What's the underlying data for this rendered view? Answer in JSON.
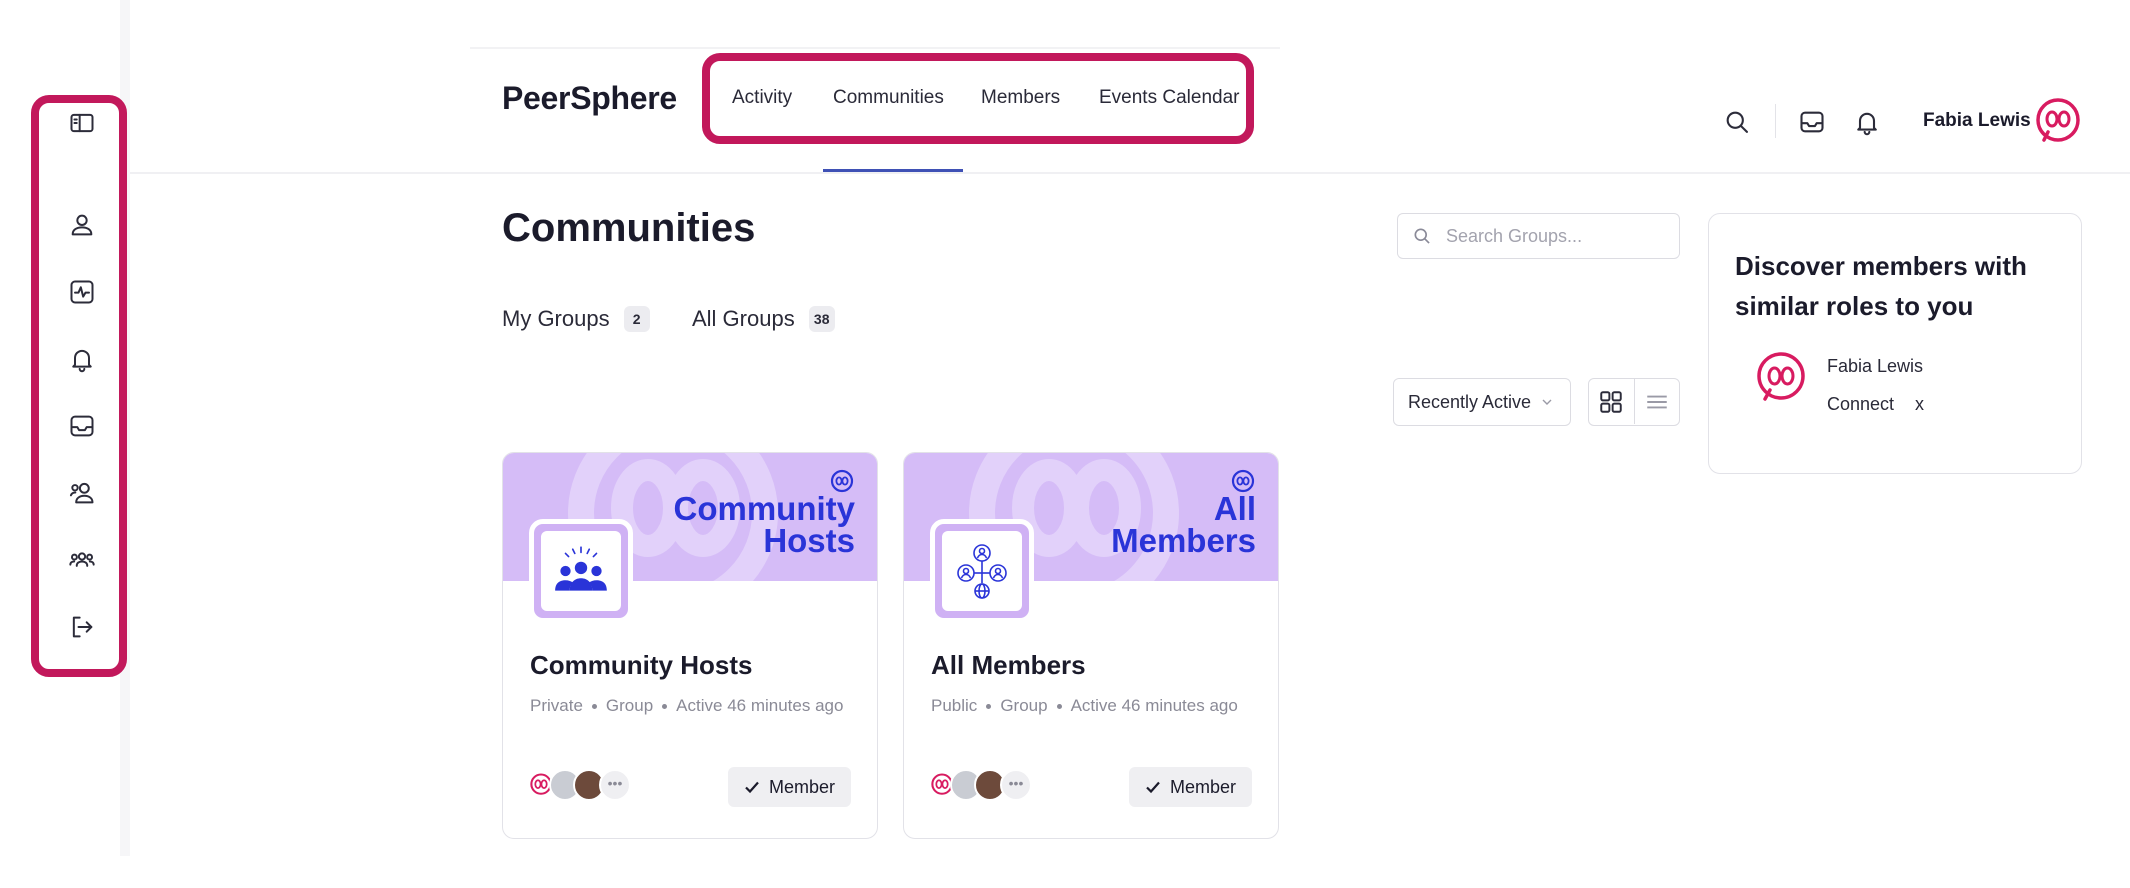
{
  "brand": "PeerSphere",
  "nav": {
    "items": [
      {
        "label": "Activity"
      },
      {
        "label": "Communities"
      },
      {
        "label": "Members"
      },
      {
        "label": "Events Calendar"
      }
    ],
    "active": "Communities"
  },
  "sidebar": {
    "icons": [
      "sidebar-toggle-icon",
      "profile-icon",
      "activity-icon",
      "notifications-icon",
      "inbox-icon",
      "connections-icon",
      "groups-icon",
      "logout-icon"
    ]
  },
  "header": {
    "icons": [
      "search-icon",
      "inbox-icon",
      "bell-icon"
    ],
    "user_name": "Fabia Lewis"
  },
  "page": {
    "title": "Communities",
    "tabs": [
      {
        "label": "My Groups",
        "count": "2"
      },
      {
        "label": "All Groups",
        "count": "38"
      }
    ],
    "search_placeholder": "Search Groups...",
    "sort_label": "Recently Active",
    "views": [
      "grid-view-icon",
      "list-view-icon"
    ]
  },
  "groups": [
    {
      "title": "Community Hosts",
      "banner_line1": "Community",
      "banner_line2": "Hosts",
      "privacy": "Private",
      "type": "Group",
      "activity": "Active 46 minutes ago",
      "status_label": "Member"
    },
    {
      "title": "All Members",
      "banner_line1": "All",
      "banner_line2": "Members",
      "privacy": "Public",
      "type": "Group",
      "activity": "Active 46 minutes ago",
      "status_label": "Member"
    }
  ],
  "discover": {
    "title": "Discover members with similar roles to you",
    "member_name": "Fabia Lewis",
    "connect_label": "Connect",
    "dismiss_label": "x"
  },
  "colors": {
    "accent": "#c2185b",
    "brand_pink": "#d81b60",
    "banner": "#d5bcf7",
    "banner_text": "#2a34d8",
    "nav_underline": "#3f51b5"
  }
}
